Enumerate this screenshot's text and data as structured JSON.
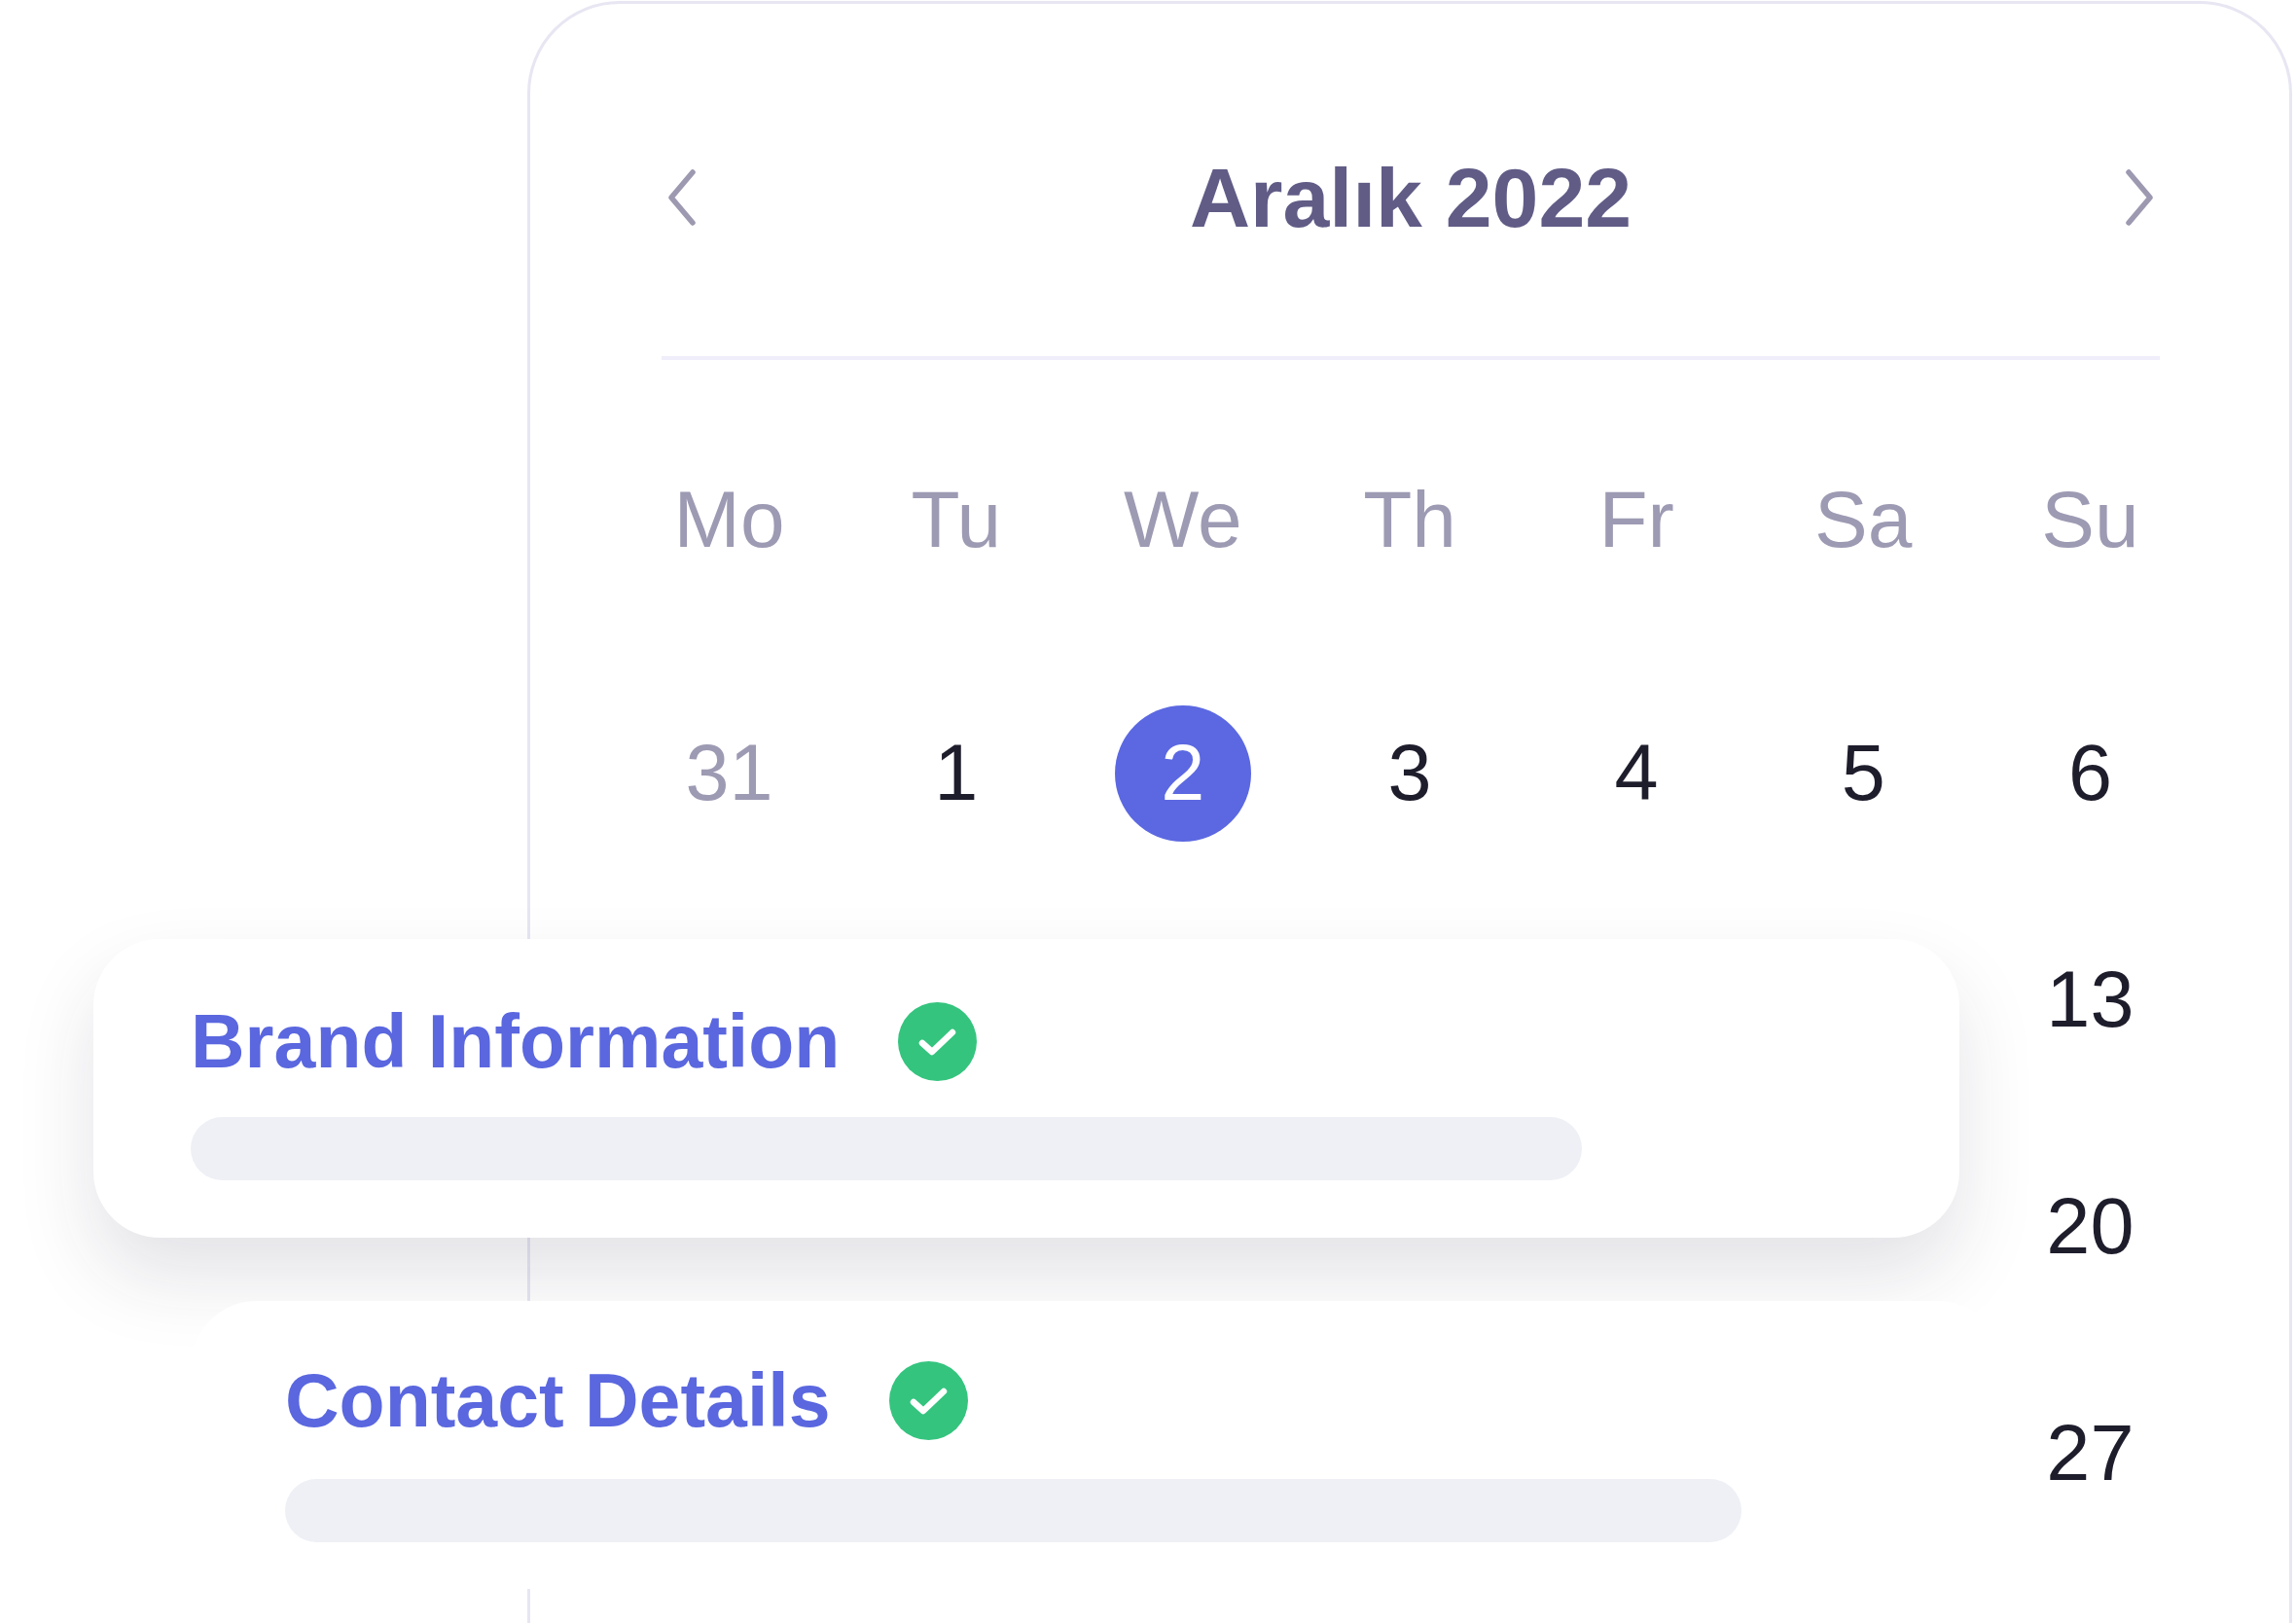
{
  "calendar": {
    "month_title": "Aralık 2022",
    "weekdays": [
      "Mo",
      "Tu",
      "We",
      "Th",
      "Fr",
      "Sa",
      "Su"
    ],
    "weeks": [
      {
        "days": [
          {
            "label": "31",
            "outside_month": true,
            "selected": false
          },
          {
            "label": "1",
            "outside_month": false,
            "selected": false
          },
          {
            "label": "2",
            "outside_month": false,
            "selected": true
          },
          {
            "label": "3",
            "outside_month": false,
            "selected": false
          },
          {
            "label": "4",
            "outside_month": false,
            "selected": false
          },
          {
            "label": "5",
            "outside_month": false,
            "selected": false
          },
          {
            "label": "6",
            "outside_month": false,
            "selected": false
          }
        ]
      },
      {
        "days": [
          {
            "label": "13",
            "outside_month": false,
            "selected": false
          }
        ]
      },
      {
        "days": [
          {
            "label": "20",
            "outside_month": false,
            "selected": false
          }
        ]
      },
      {
        "days": [
          {
            "label": "27",
            "outside_month": false,
            "selected": false
          }
        ]
      }
    ]
  },
  "steps": [
    {
      "title": "Brand Information",
      "completed": true
    },
    {
      "title": "Contact Details",
      "completed": true
    }
  ]
}
